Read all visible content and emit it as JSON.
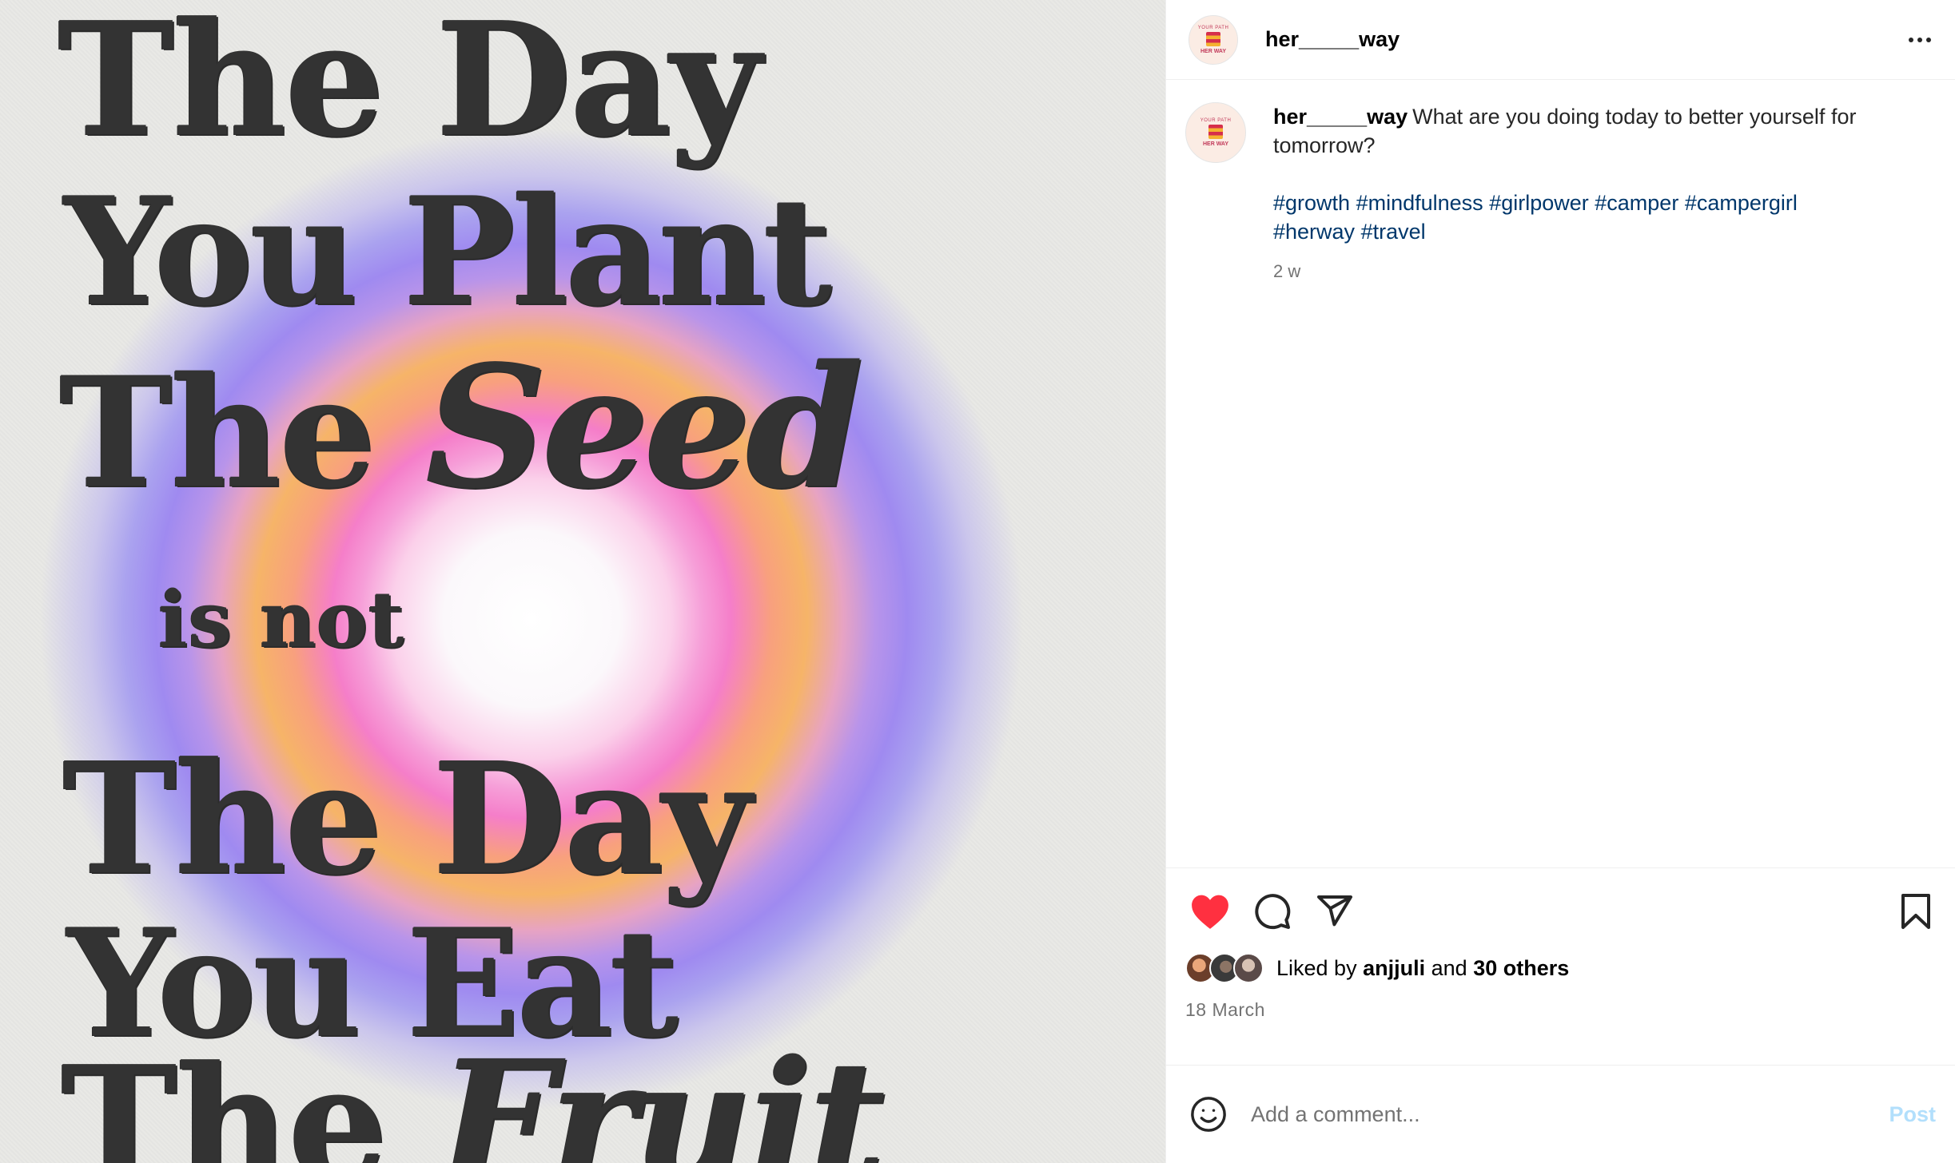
{
  "media": {
    "poster_lines": {
      "l1": "The Day",
      "l2": "You Plant",
      "l3_a": "The ",
      "l3_b": "Seed",
      "l4": "is not",
      "l5": "The Day",
      "l6": "You Eat",
      "l7_a": "The ",
      "l7_b": "Fruit"
    },
    "glow_colors": [
      "#ffffff",
      "#f57ec9",
      "#f6b468",
      "#9f8af0"
    ]
  },
  "header": {
    "username": "her_____way",
    "more_icon": "more-horizontal-icon"
  },
  "avatar": {
    "logo_top_text": "YOUR PATH",
    "logo_text": "HER WAY"
  },
  "caption": {
    "username": "her_____way",
    "text": "What are you doing today to better yourself for tomorrow?",
    "hashtags": [
      "#growth",
      "#mindfulness",
      "#girlpower",
      "#camper",
      "#campergirl",
      "#herway",
      "#travel"
    ],
    "time_ago": "2 w"
  },
  "actions": {
    "like_icon": "heart-filled-icon",
    "like_color": "#ff3040",
    "comment_icon": "comment-icon",
    "share_icon": "send-icon",
    "save_icon": "bookmark-icon"
  },
  "likes": {
    "prefix": "Liked by",
    "user": "anjjuli",
    "connector": "and",
    "others": "30 others"
  },
  "post_date": "18 March",
  "comment_bar": {
    "emoji_icon": "emoji-icon",
    "placeholder": "Add a comment...",
    "post_label": "Post",
    "post_color": "#b2dffc"
  }
}
